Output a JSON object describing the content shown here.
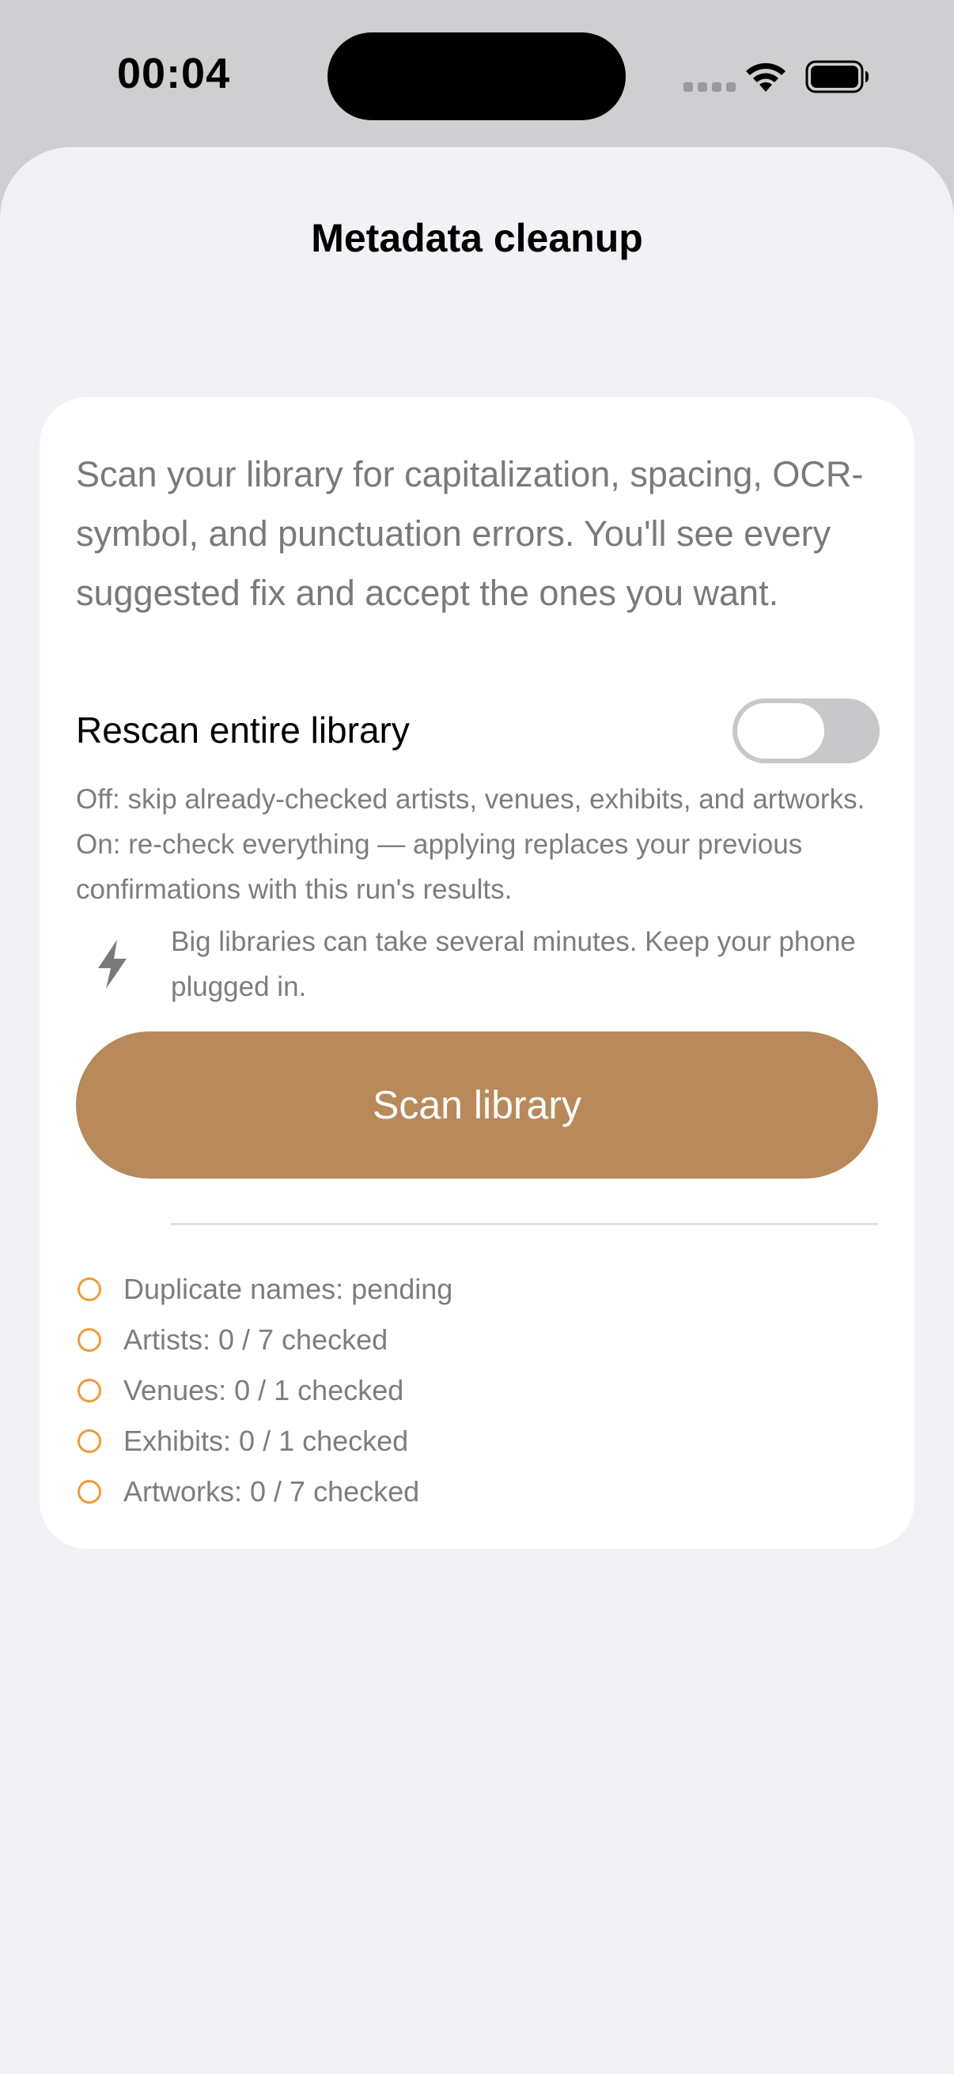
{
  "status_bar": {
    "time": "00:04"
  },
  "nav": {
    "title": "Metadata cleanup"
  },
  "card": {
    "intro": "Scan your library for capitalization, spacing, OCR-symbol, and punctuation errors. You'll see every suggested fix and accept the ones you want.",
    "toggle_label": "Rescan entire library",
    "toggle_on": false,
    "toggle_description": "Off: skip already-checked artists, venues, exhibits, and artworks. On: re-check everything — applying replaces your previous confirmations with this run's results.",
    "tip_icon": "bolt-icon",
    "tip": "Big libraries can take several minutes. Keep your phone plugged in.",
    "scan_button_label": "Scan library",
    "status_items": [
      {
        "label": "Duplicate names: pending"
      },
      {
        "label": "Artists: 0 / 7 checked"
      },
      {
        "label": "Venues: 0 / 1 checked"
      },
      {
        "label": "Exhibits: 0 / 1 checked"
      },
      {
        "label": "Artworks: 0 / 7 checked"
      }
    ]
  },
  "colors": {
    "accent": "#b8895a",
    "pending": "#ee9a3a",
    "background": "#f1f1f6"
  }
}
